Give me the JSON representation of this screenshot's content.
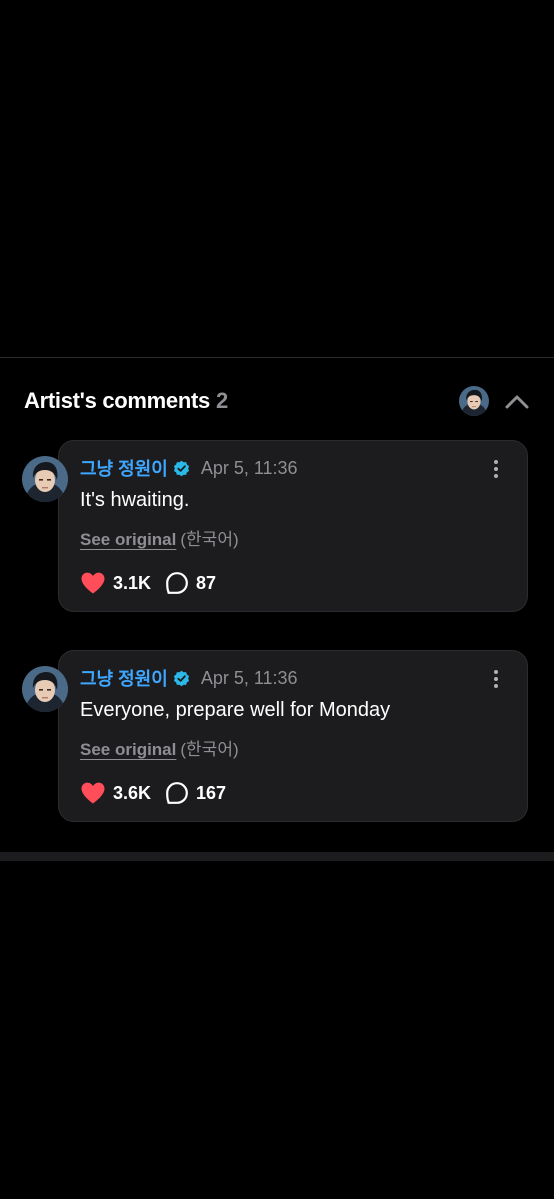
{
  "section": {
    "title": "Artist's comments",
    "count": "2"
  },
  "colors": {
    "background": "#000000",
    "card": "#1c1c1e",
    "author": "#3ea6ff",
    "verified": "#2bb9e8",
    "heart": "#ff4d5a",
    "muted": "#8e8e93"
  },
  "comments": [
    {
      "author": "그냥 정원이",
      "timestamp": "Apr 5, 11:36",
      "text": "It's hwaiting.",
      "see_original": "See original",
      "original_language": "(한국어)",
      "likes": "3.1K",
      "replies": "87"
    },
    {
      "author": "그냥 정원이",
      "timestamp": "Apr 5, 11:36",
      "text": "Everyone, prepare well for Monday",
      "see_original": "See original",
      "original_language": "(한국어)",
      "likes": "3.6K",
      "replies": "167"
    }
  ]
}
